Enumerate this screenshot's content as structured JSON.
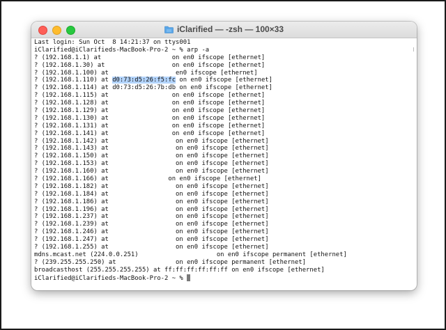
{
  "window": {
    "title": "iClarified — -zsh — 100×33",
    "folder_icon": "folder-icon",
    "controls": [
      "close-button",
      "minimize-button",
      "zoom-button"
    ]
  },
  "terminal": {
    "lines": [
      "Last login: Sun Oct  8 14:21:37 on ttys001",
      "iClarified@iClarifieds-MacBook-Pro-2 ~ % arp -a",
      "? (192.168.1.1) at                   on en0 ifscope [ethernet]",
      "? (192.168.1.30) at                  on en0 ifscope [ethernet]",
      "? (192.168.1.100) at                  en0 ifscope [ethernet]",
      "? (192.168.1.110) at |d0:73:d5:26:f5:fc| on en0 ifscope [ethernet]",
      "? (192.168.1.114) at d0:73:d5:26:7b:db on en0 ifscope [ethernet]",
      "? (192.168.1.115) at                 on en0 ifscope [ethernet]",
      "? (192.168.1.128) at                 on en0 ifscope [ethernet]",
      "? (192.168.1.129) at                 on en0 ifscope [ethernet]",
      "? (192.168.1.130) at                 on en0 ifscope [ethernet]",
      "? (192.168.1.131) at                 on en0 ifscope [ethernet]",
      "? (192.168.1.141) at                 on en0 ifscope [ethernet]",
      "? (192.168.1.142) at                  on en0 ifscope [ethernet]",
      "? (192.168.1.143) at                  on en0 ifscope [ethernet]",
      "? (192.168.1.150) at                  on en0 ifscope [ethernet]",
      "? (192.168.1.153) at                  on en0 ifscope [ethernet]",
      "? (192.168.1.160) at                  on en0 ifscope [ethernet]",
      "? (192.168.1.166) at                on en0 ifscope [ethernet]",
      "? (192.168.1.182) at                  on en0 ifscope [ethernet]",
      "? (192.168.1.184) at                  on en0 ifscope [ethernet]",
      "? (192.168.1.186) at                  on en0 ifscope [ethernet]",
      "? (192.168.1.196) at                  on en0 ifscope [ethernet]",
      "? (192.168.1.237) at                  on en0 ifscope [ethernet]",
      "? (192.168.1.239) at                  on en0 ifscope [ethernet]",
      "? (192.168.1.246) at                  on en0 ifscope [ethernet]",
      "? (192.168.1.247) at                  on en0 ifscope [ethernet]",
      "? (192.168.1.255) at                  on en0 ifscope [ethernet]",
      "mdns.mcast.net (224.0.0.251)                     on en0 ifscope permanent [ethernet]",
      "? (239.255.255.250) at                on en0 ifscope permanent [ethernet]",
      "broadcasthost (255.255.255.255) at ff:ff:ff:ff:ff:ff on en0 ifscope [ethernet]"
    ],
    "prompt": "iClarified@iClarifieds-MacBook-Pro-2 ~ % "
  }
}
